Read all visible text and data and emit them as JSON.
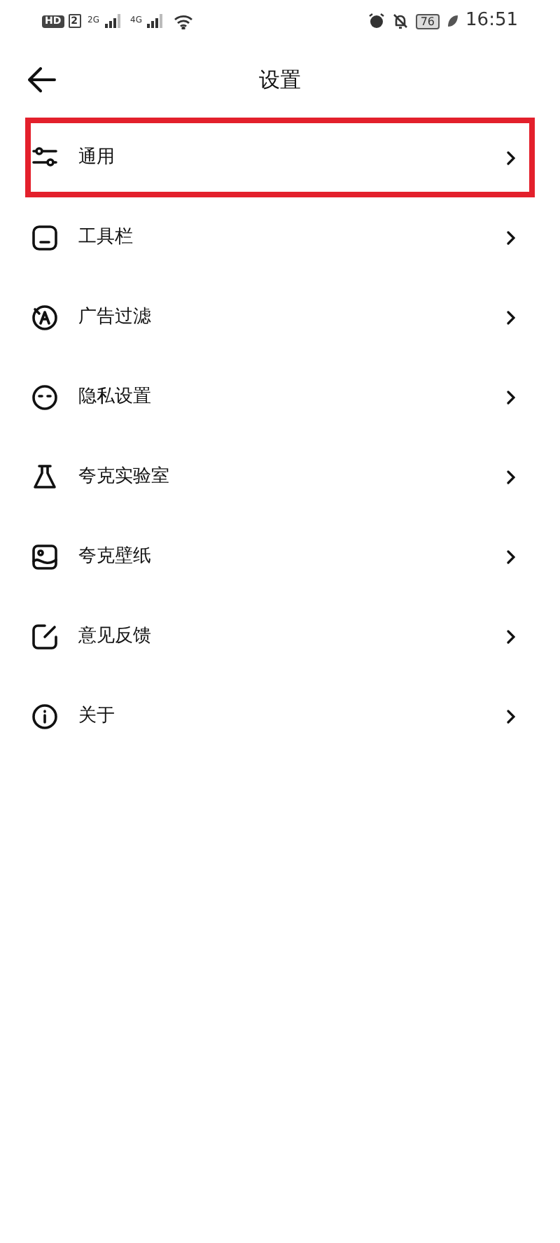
{
  "status_bar": {
    "hd": "HD",
    "sim": "2",
    "network_1": "2G",
    "network_2": "4G",
    "battery": "76",
    "time": "16:51"
  },
  "header": {
    "title": "设置"
  },
  "items": [
    {
      "label": "通用",
      "selected": true
    },
    {
      "label": "工具栏",
      "selected": false
    },
    {
      "label": "广告过滤",
      "selected": false
    },
    {
      "label": "隐私设置",
      "selected": false
    },
    {
      "label": "夸克实验室",
      "selected": false
    },
    {
      "label": "夸克壁纸",
      "selected": false
    },
    {
      "label": "意见反馈",
      "selected": false
    },
    {
      "label": "关于",
      "selected": false
    }
  ]
}
